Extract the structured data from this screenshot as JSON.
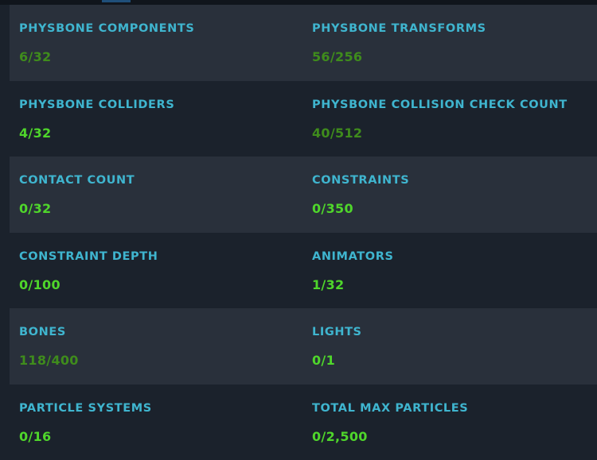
{
  "colors": {
    "background": "#1b222c",
    "row_shade": "#29303b",
    "label": "#3fb5cf",
    "value_ok": "#4fd62b",
    "value_dim": "#3f8c1c"
  },
  "rows": [
    {
      "left": {
        "label": "PHYSBONE COMPONENTS",
        "value": "6/32",
        "status": "dim"
      },
      "right": {
        "label": "PHYSBONE TRANSFORMS",
        "value": "56/256",
        "status": "dim"
      }
    },
    {
      "left": {
        "label": "PHYSBONE COLLIDERS",
        "value": "4/32",
        "status": "ok"
      },
      "right": {
        "label": "PHYSBONE COLLISION CHECK COUNT",
        "value": "40/512",
        "status": "dim"
      }
    },
    {
      "left": {
        "label": "CONTACT COUNT",
        "value": "0/32",
        "status": "ok"
      },
      "right": {
        "label": "CONSTRAINTS",
        "value": "0/350",
        "status": "ok"
      }
    },
    {
      "left": {
        "label": "CONSTRAINT DEPTH",
        "value": "0/100",
        "status": "ok"
      },
      "right": {
        "label": "ANIMATORS",
        "value": "1/32",
        "status": "ok"
      }
    },
    {
      "left": {
        "label": "BONES",
        "value": "118/400",
        "status": "dim"
      },
      "right": {
        "label": "LIGHTS",
        "value": "0/1",
        "status": "ok"
      }
    },
    {
      "left": {
        "label": "PARTICLE SYSTEMS",
        "value": "0/16",
        "status": "ok"
      },
      "right": {
        "label": "TOTAL MAX PARTICLES",
        "value": "0/2,500",
        "status": "ok"
      }
    }
  ]
}
